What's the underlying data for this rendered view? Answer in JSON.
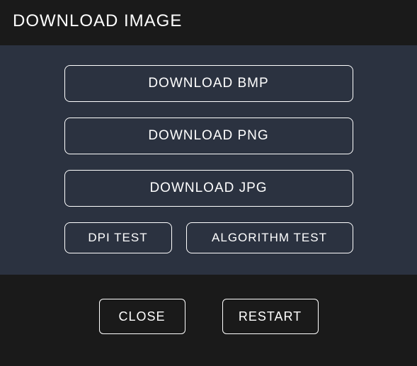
{
  "header": {
    "title": "DOWNLOAD IMAGE"
  },
  "main": {
    "buttons": {
      "bmp": "DOWNLOAD BMP",
      "png": "DOWNLOAD PNG",
      "jpg": "DOWNLOAD JPG"
    },
    "tests": {
      "dpi": "DPI TEST",
      "algorithm": "ALGORITHM TEST"
    }
  },
  "footer": {
    "close": "CLOSE",
    "restart": "RESTART"
  }
}
